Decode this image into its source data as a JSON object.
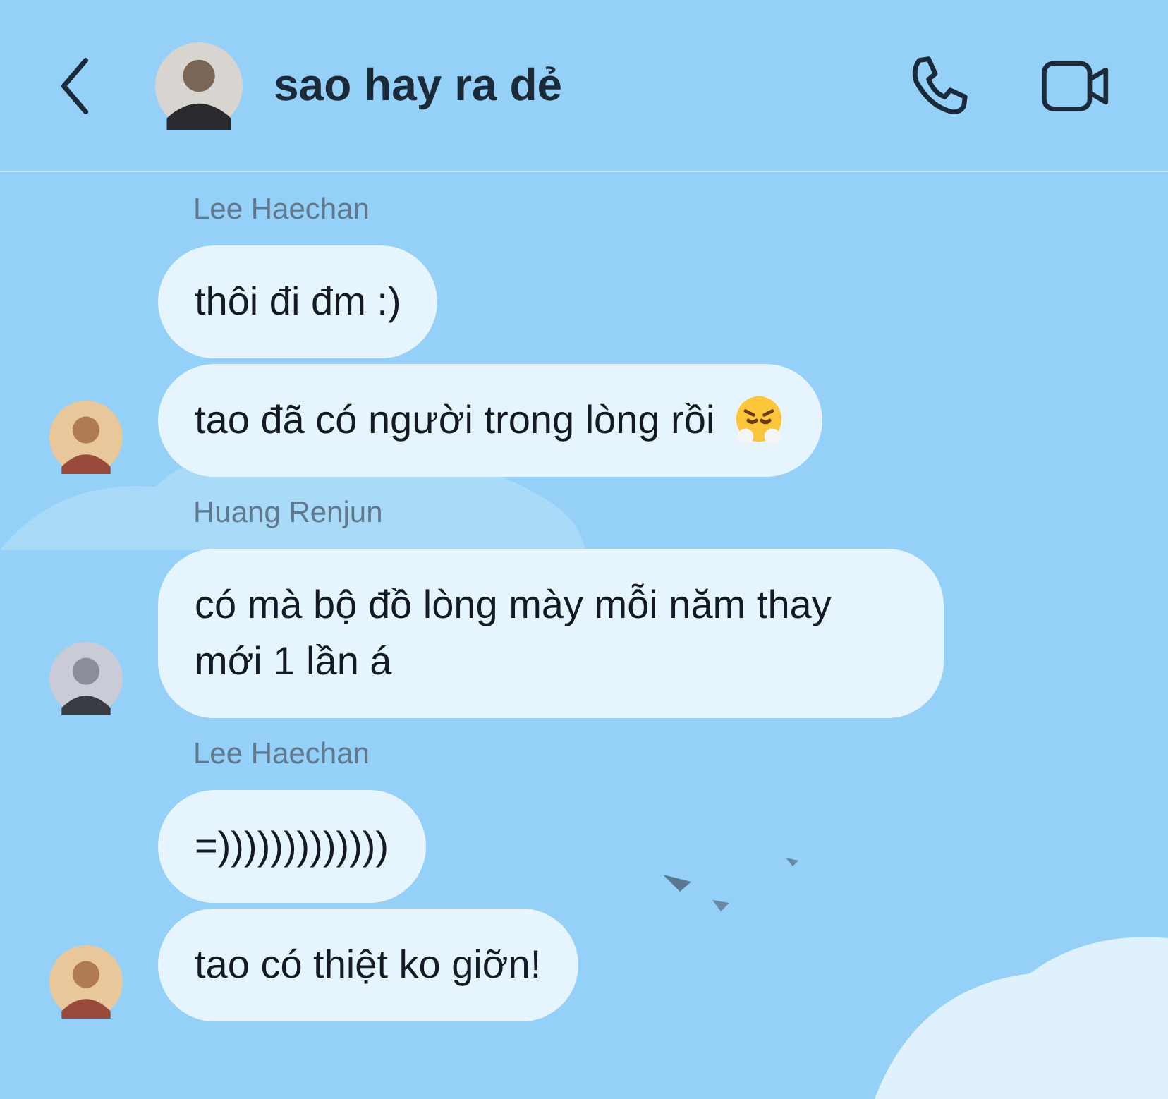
{
  "header": {
    "title": "sao hay ra dẻ"
  },
  "groups": [
    {
      "sender": "Lee Haechan",
      "messages": [
        {
          "kind": "plain",
          "text": "thôi đi đm :)"
        },
        {
          "kind": "with-emoji",
          "text": "tao đã có người trong lòng rồi"
        }
      ]
    },
    {
      "sender": "Huang Renjun",
      "messages": [
        {
          "kind": "plain",
          "text": "có mà bộ đồ lòng mày mỗi năm thay mới 1 lần á"
        }
      ]
    },
    {
      "sender": "Lee Haechan",
      "messages": [
        {
          "kind": "plain",
          "text": "=)))))))))))))"
        },
        {
          "kind": "plain",
          "text": "tao có thiệt ko giỡn!"
        }
      ]
    }
  ]
}
